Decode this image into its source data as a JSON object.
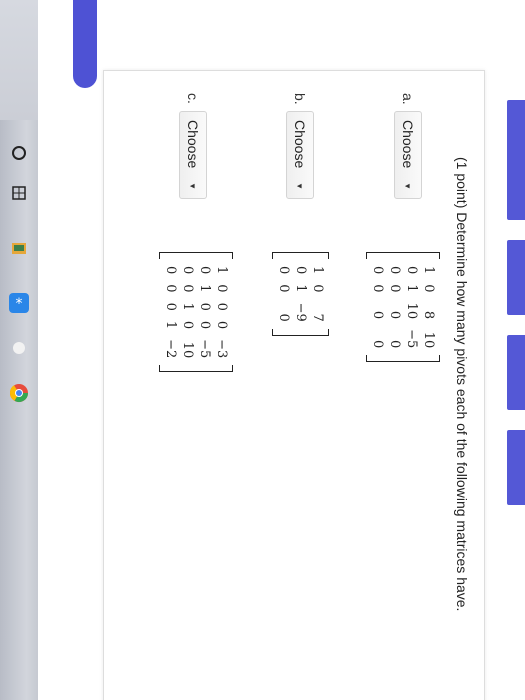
{
  "problem": {
    "title": "(1 point) Determine how many pivots each of the following matrices have."
  },
  "parts": [
    {
      "letter": "a.",
      "select": "Choose",
      "matrix": [
        [
          "1",
          "0",
          "8",
          "10"
        ],
        [
          "0",
          "1",
          "10",
          "−5"
        ],
        [
          "0",
          "0",
          "0",
          "0"
        ],
        [
          "0",
          "0",
          "0",
          "0"
        ]
      ]
    },
    {
      "letter": "b.",
      "select": "Choose",
      "matrix": [
        [
          "1",
          "0",
          "7"
        ],
        [
          "0",
          "1",
          "−9"
        ],
        [
          "0",
          "0",
          "0"
        ]
      ]
    },
    {
      "letter": "c.",
      "select": "Choose",
      "matrix": [
        [
          "1",
          "0",
          "0",
          "0",
          "−3"
        ],
        [
          "0",
          "1",
          "0",
          "0",
          "−5"
        ],
        [
          "0",
          "0",
          "1",
          "0",
          "10"
        ],
        [
          "0",
          "0",
          "0",
          "1",
          "−2"
        ]
      ]
    }
  ],
  "dock": {
    "icons": [
      "circle-icon",
      "grid-icon",
      "folder-icon",
      "bluetooth-icon",
      "dot-icon",
      "chrome-icon"
    ]
  },
  "colors": {
    "accent": "#5458d6"
  }
}
